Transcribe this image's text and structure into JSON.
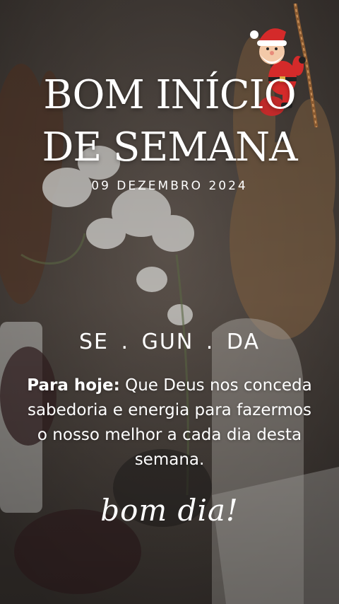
{
  "headline": {
    "line1": "BOM INÍCIO",
    "line2": "DE SEMANA"
  },
  "date": "09 DEZEMBRO 2024",
  "weekday": "SE . GUN . DA",
  "message": {
    "lead": "Para hoje:",
    "text": " Que Deus nos conceda sabedoria e energia para fazermos o nosso melhor a cada dia desta semana."
  },
  "signature": "bom dia!",
  "colors": {
    "text": "#ffffff",
    "santa_red": "#d42a2a",
    "background": "#4a4440"
  },
  "icons": {
    "decoration": "santa-claus-climbing-rope-icon"
  }
}
